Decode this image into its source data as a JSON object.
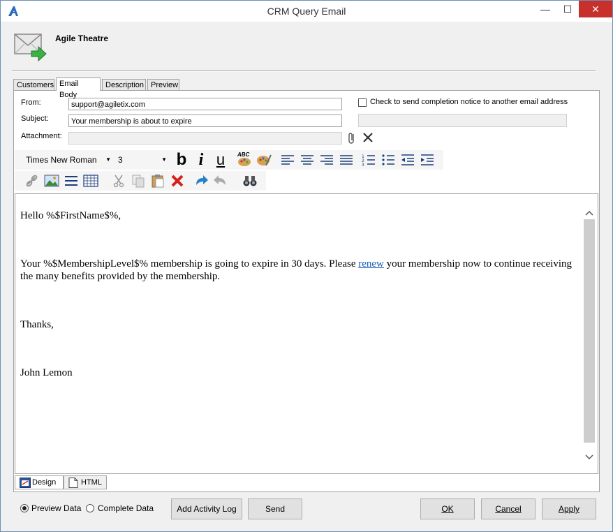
{
  "window": {
    "title": "CRM Query Email",
    "minimize_glyph": "—",
    "maximize_glyph": "☐",
    "close_glyph": "✕"
  },
  "header": {
    "company_name": "Agile Theatre"
  },
  "tabs": [
    {
      "label": "Customers",
      "active": false
    },
    {
      "label": "Email Body",
      "active": true
    },
    {
      "label": "Description",
      "active": false
    },
    {
      "label": "Preview",
      "active": false
    }
  ],
  "form": {
    "from_label": "From:",
    "from_value": "support@agiletix.com",
    "subject_label": "Subject:",
    "subject_value": "Your membership is about to expire",
    "attachment_label": "Attachment:",
    "attachment_value": "",
    "notice_checkbox_label": "Check to send completion notice to another email address",
    "notice_checked": false,
    "notice_email_value": ""
  },
  "format_toolbar": {
    "font_family": "Times New Roman",
    "font_size": "3",
    "bold_glyph": "b",
    "italic_glyph": "i",
    "underline_glyph": "u",
    "spell_text": "ABC"
  },
  "editor": {
    "greeting": "Hello %$FirstName$%,",
    "body_before_link": "Your %$MembershipLevel$% membership is going to expire in 30 days.  Please ",
    "link_text": "renew",
    "body_after_link": " your membership now to continue receiving the many benefits provided by the membership.",
    "closing": "Thanks,",
    "signature": "John Lemon"
  },
  "editor_modes": [
    {
      "label": "Design",
      "active": true
    },
    {
      "label": "HTML",
      "active": false
    }
  ],
  "data_options": {
    "preview_label": "Preview Data",
    "complete_label": "Complete Data",
    "selected": "Preview Data"
  },
  "buttons": {
    "add_activity_log": "Add Activity Log",
    "send": "Send",
    "ok": "OK",
    "cancel": "Cancel",
    "apply": "Apply"
  },
  "colors": {
    "close_button": "#c7302b",
    "link": "#1a5fb4",
    "delete_icon": "#d62020"
  }
}
